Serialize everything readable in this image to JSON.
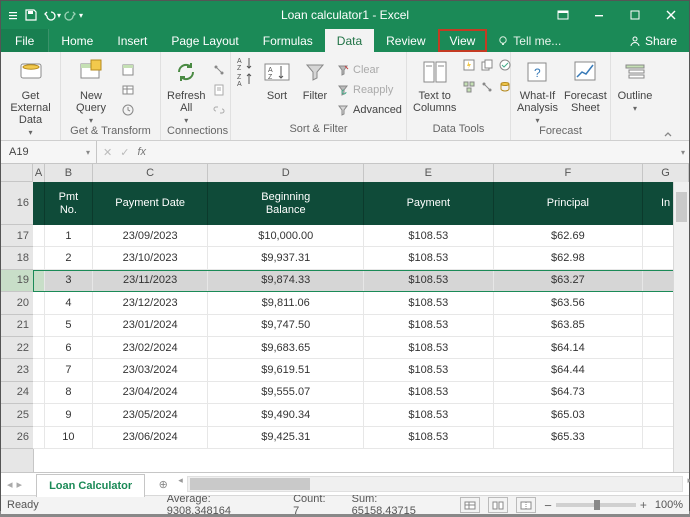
{
  "title": "Loan calculator1 - Excel",
  "qat": {
    "save": "save",
    "undo": "undo",
    "redo": "redo"
  },
  "window_controls": {
    "min": "minimize",
    "restore": "restore",
    "close": "close"
  },
  "tabs": {
    "file": "File",
    "home": "Home",
    "insert": "Insert",
    "page_layout": "Page Layout",
    "formulas": "Formulas",
    "data": "Data",
    "review": "Review",
    "view": "View",
    "tell_me": "Tell me...",
    "share": "Share"
  },
  "ribbon": {
    "get_external": "Get External\nData",
    "new_query": "New\nQuery",
    "refresh_all": "Refresh\nAll",
    "get_transform": "Get & Transform",
    "connections": "Connections",
    "sort": "Sort",
    "filter": "Filter",
    "clear": "Clear",
    "reapply": "Reapply",
    "advanced": "Advanced",
    "sort_filter": "Sort & Filter",
    "text_to_columns": "Text to\nColumns",
    "data_tools": "Data Tools",
    "what_if": "What-If\nAnalysis",
    "forecast_sheet": "Forecast\nSheet",
    "forecast": "Forecast",
    "outline": "Outline"
  },
  "namebox": "A19",
  "columns": [
    "A",
    "B",
    "C",
    "D",
    "E",
    "F",
    "G"
  ],
  "row_start": 16,
  "headers": {
    "b": "Pmt\nNo.",
    "c": "Payment Date",
    "d": "Beginning\nBalance",
    "e": "Payment",
    "f": "Principal",
    "g": "In"
  },
  "rows": [
    {
      "no": "1",
      "date": "23/09/2023",
      "bb": "$10,000.00",
      "pay": "$108.53",
      "prin": "$62.69"
    },
    {
      "no": "2",
      "date": "23/10/2023",
      "bb": "$9,937.31",
      "pay": "$108.53",
      "prin": "$62.98"
    },
    {
      "no": "3",
      "date": "23/11/2023",
      "bb": "$9,874.33",
      "pay": "$108.53",
      "prin": "$63.27"
    },
    {
      "no": "4",
      "date": "23/12/2023",
      "bb": "$9,811.06",
      "pay": "$108.53",
      "prin": "$63.56"
    },
    {
      "no": "5",
      "date": "23/01/2024",
      "bb": "$9,747.50",
      "pay": "$108.53",
      "prin": "$63.85"
    },
    {
      "no": "6",
      "date": "23/02/2024",
      "bb": "$9,683.65",
      "pay": "$108.53",
      "prin": "$64.14"
    },
    {
      "no": "7",
      "date": "23/03/2024",
      "bb": "$9,619.51",
      "pay": "$108.53",
      "prin": "$64.44"
    },
    {
      "no": "8",
      "date": "23/04/2024",
      "bb": "$9,555.07",
      "pay": "$108.53",
      "prin": "$64.73"
    },
    {
      "no": "9",
      "date": "23/05/2024",
      "bb": "$9,490.34",
      "pay": "$108.53",
      "prin": "$65.03"
    },
    {
      "no": "10",
      "date": "23/06/2024",
      "bb": "$9,425.31",
      "pay": "$108.53",
      "prin": "$65.33"
    }
  ],
  "selected_row_index": 2,
  "sheet_tab": "Loan Calculator",
  "status": {
    "ready": "Ready",
    "average": "Average: 9308.348164",
    "count": "Count: 7",
    "sum": "Sum: 65158.43715",
    "zoom": "100%"
  }
}
